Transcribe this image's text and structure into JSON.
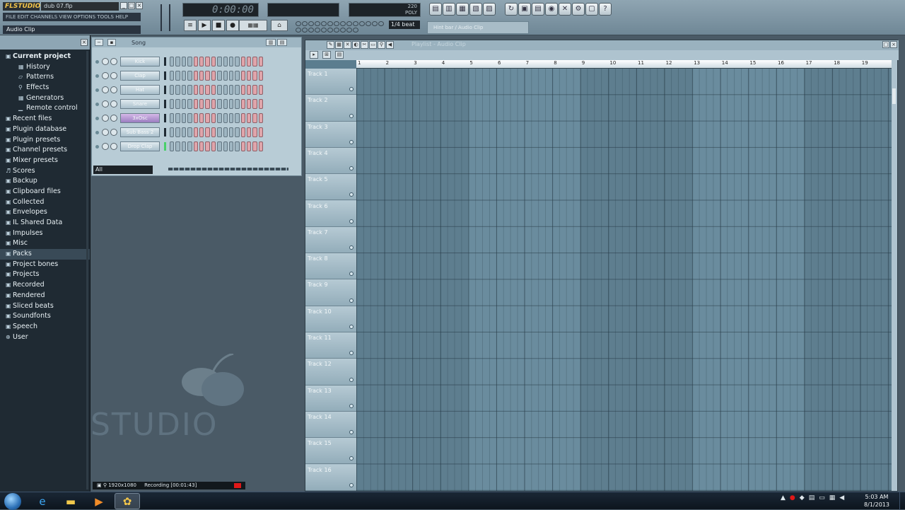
{
  "app": {
    "logo": "FLSTUDIO",
    "project_name": "dub 07.flp",
    "menu_strip": "FILE EDIT CHANNELS VIEW OPTIONS TOOLS HELP",
    "hint_left": "Audio Clip",
    "hint_right": "Audio Clip",
    "time_display": "0:00:00",
    "snap_value": "1/4 beat",
    "hint_bar": "Hint bar / Audio Clip"
  },
  "browser": {
    "title": "",
    "items": [
      {
        "label": "Current project",
        "glyph": "▣",
        "type": "root"
      },
      {
        "label": "History",
        "glyph": "▦",
        "type": "child"
      },
      {
        "label": "Patterns",
        "glyph": "▱",
        "type": "child"
      },
      {
        "label": "Effects",
        "glyph": "⚲",
        "type": "child"
      },
      {
        "label": "Generators",
        "glyph": "▦",
        "type": "child"
      },
      {
        "label": "Remote control",
        "glyph": "▁",
        "type": "child"
      },
      {
        "label": "Recent files",
        "glyph": "▣",
        "type": "root"
      },
      {
        "label": "Plugin database",
        "glyph": "▣",
        "type": "root"
      },
      {
        "label": "Plugin presets",
        "glyph": "▣",
        "type": "root"
      },
      {
        "label": "Channel presets",
        "glyph": "▣",
        "type": "root"
      },
      {
        "label": "Mixer presets",
        "glyph": "▣",
        "type": "root"
      },
      {
        "label": "Scores",
        "glyph": "♬",
        "type": "root"
      },
      {
        "label": "Backup",
        "glyph": "▣",
        "type": "root"
      },
      {
        "label": "Clipboard files",
        "glyph": "▣",
        "type": "root"
      },
      {
        "label": "Collected",
        "glyph": "▣",
        "type": "root"
      },
      {
        "label": "Envelopes",
        "glyph": "▣",
        "type": "root"
      },
      {
        "label": "IL Shared Data",
        "glyph": "▣",
        "type": "root"
      },
      {
        "label": "Impulses",
        "glyph": "▣",
        "type": "root"
      },
      {
        "label": "Misc",
        "glyph": "▣",
        "type": "root"
      },
      {
        "label": "Packs",
        "glyph": "▣",
        "type": "selected"
      },
      {
        "label": "Project bones",
        "glyph": "▣",
        "type": "root"
      },
      {
        "label": "Projects",
        "glyph": "▣",
        "type": "root"
      },
      {
        "label": "Recorded",
        "glyph": "▣",
        "type": "root"
      },
      {
        "label": "Rendered",
        "glyph": "▣",
        "type": "root"
      },
      {
        "label": "Sliced beats",
        "glyph": "▣",
        "type": "root"
      },
      {
        "label": "Soundfonts",
        "glyph": "▣",
        "type": "root"
      },
      {
        "label": "Speech",
        "glyph": "▣",
        "type": "root"
      },
      {
        "label": "User",
        "glyph": "⊕",
        "type": "root"
      }
    ]
  },
  "stepseq": {
    "song_label": "Song",
    "filter": "All",
    "channels": [
      {
        "name": "Kick",
        "purple": false,
        "led": false
      },
      {
        "name": "Clap",
        "purple": false,
        "led": false
      },
      {
        "name": "Hat",
        "purple": false,
        "led": false
      },
      {
        "name": "Snare",
        "purple": false,
        "led": false
      },
      {
        "name": "3xOsc",
        "purple": true,
        "led": false
      },
      {
        "name": "Sub Bass 2",
        "purple": false,
        "led": false
      },
      {
        "name": "Drop Clap",
        "purple": false,
        "led": true
      }
    ]
  },
  "background_logo": "STUDIO",
  "playlist": {
    "title": "Playlist - Audio Clip",
    "ruler": [
      "1",
      "2",
      "3",
      "4",
      "5",
      "6",
      "7",
      "8",
      "9",
      "10",
      "11",
      "12",
      "13",
      "14",
      "15",
      "16",
      "17",
      "18",
      "19"
    ],
    "tracks": [
      "Track 1",
      "Track 2",
      "Track 3",
      "Track 4",
      "Track 5",
      "Track 6",
      "Track 7",
      "Track 8",
      "Track 9",
      "Track 10",
      "Track 11",
      "Track 12",
      "Track 13",
      "Track 14",
      "Track 15",
      "Track 16"
    ]
  },
  "recording_bar": {
    "resolution": "1920x1080",
    "status": "Recording [00:01:43]"
  },
  "taskbar": {
    "time": "5:03 AM",
    "date": "8/1/2013"
  }
}
